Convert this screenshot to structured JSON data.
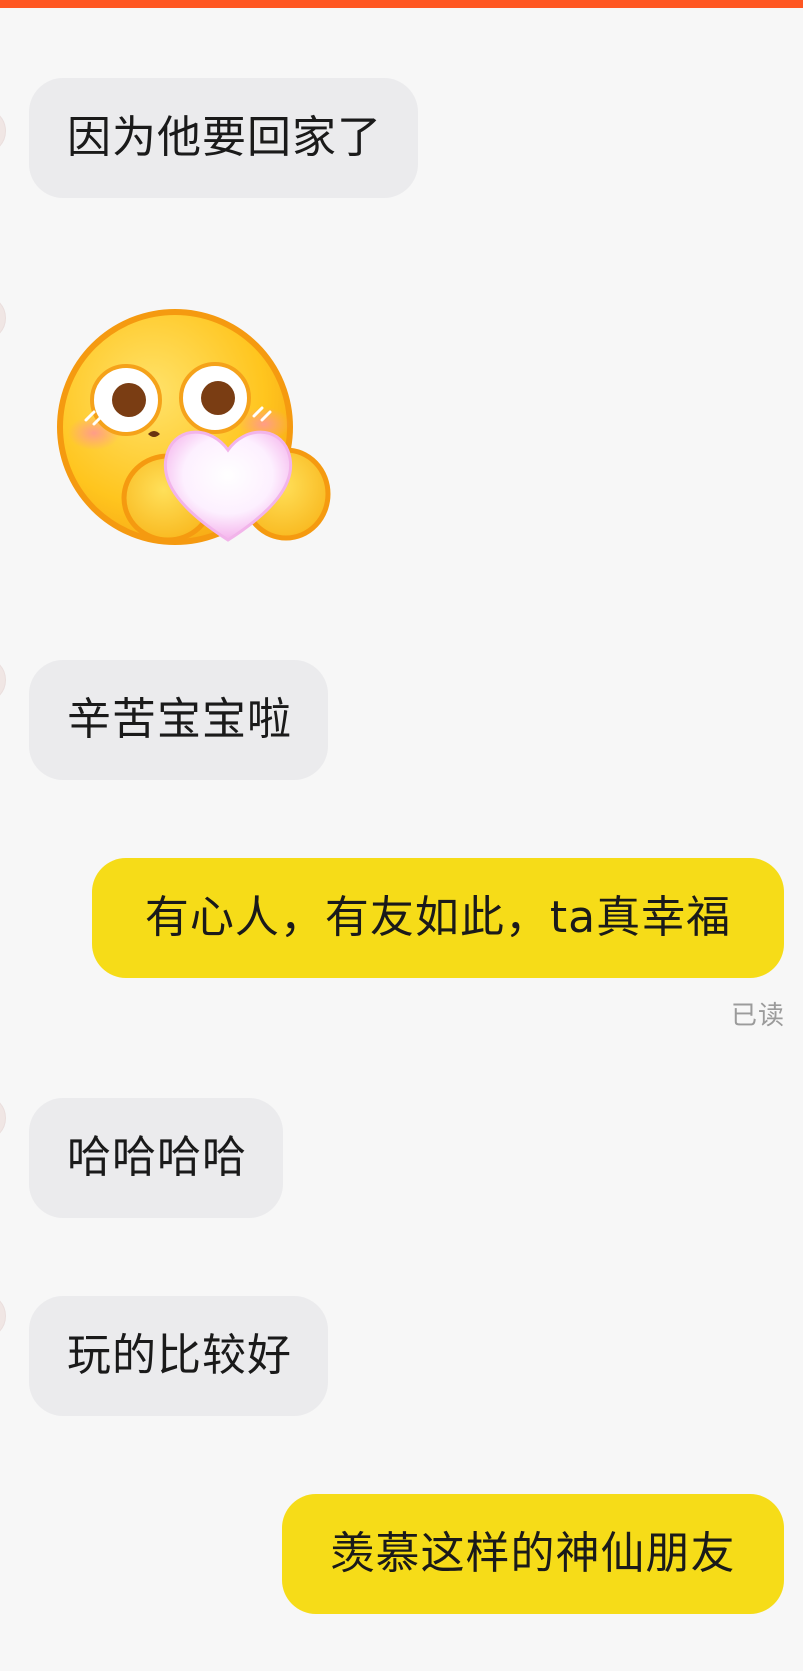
{
  "chat": {
    "messages": [
      {
        "side": "incoming",
        "type": "text",
        "text": "因为他要回家了"
      },
      {
        "side": "incoming",
        "type": "sticker",
        "sticker_icon": "blushing-face-holding-heart-sticker"
      },
      {
        "side": "incoming",
        "type": "text",
        "text": "辛苦宝宝啦"
      },
      {
        "side": "outgoing",
        "type": "text",
        "text": "有心人，有友如此，ta真幸福"
      },
      {
        "side": "incoming",
        "type": "text",
        "text": "哈哈哈哈"
      },
      {
        "side": "incoming",
        "type": "text",
        "text": "玩的比较好"
      },
      {
        "side": "outgoing",
        "type": "text",
        "text": "羡慕这样的神仙朋友"
      }
    ],
    "read_receipt": "已读"
  },
  "colors": {
    "top_accent": "#ff5722",
    "incoming_bubble": "#ebebed",
    "outgoing_bubble": "#f6dc18",
    "background": "#f7f7f7",
    "receipt_text": "#9b9b9b"
  }
}
